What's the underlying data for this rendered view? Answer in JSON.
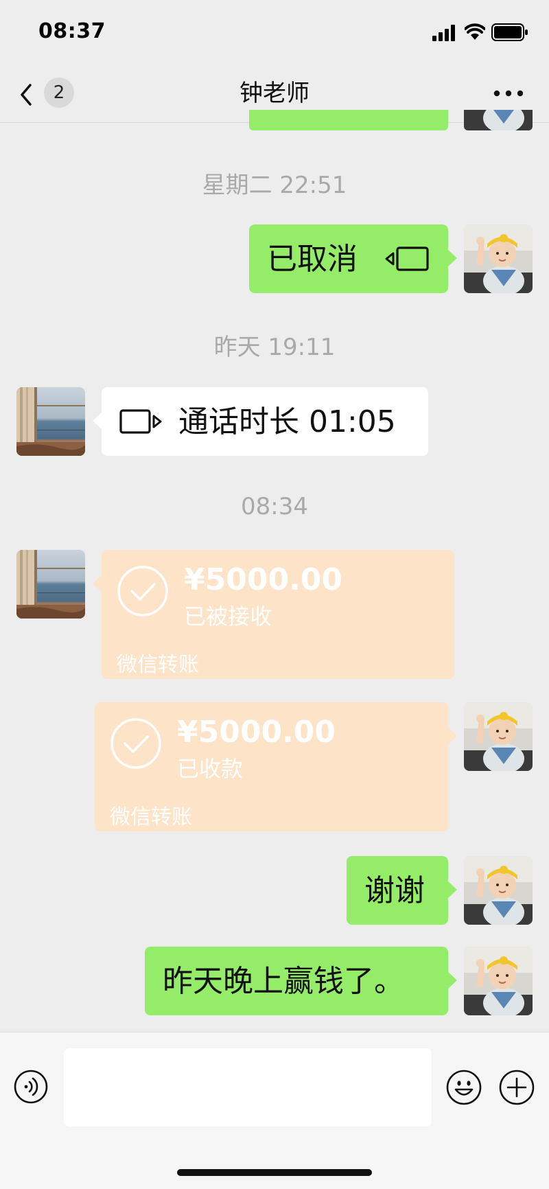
{
  "status_bar": {
    "time": "08:37"
  },
  "header": {
    "unread_count": "2",
    "title": "钟老师"
  },
  "messages": [
    {
      "type": "time",
      "text": "星期二 22:51"
    },
    {
      "type": "call",
      "from": "me",
      "text": "已取消",
      "icon": "video-call-icon"
    },
    {
      "type": "time",
      "text": "昨天 19:11"
    },
    {
      "type": "call",
      "from": "them",
      "text": "通话时长 01:05",
      "icon": "video-call-icon"
    },
    {
      "type": "time",
      "text": "08:34"
    },
    {
      "type": "transfer",
      "from": "them",
      "amount": "¥5000.00",
      "status": "已被接收",
      "label": "微信转账"
    },
    {
      "type": "transfer",
      "from": "me",
      "amount": "¥5000.00",
      "status": "已收款",
      "label": "微信转账"
    },
    {
      "type": "text",
      "from": "me",
      "text": "谢谢"
    },
    {
      "type": "text",
      "from": "me",
      "text": "昨天晚上赢钱了。"
    }
  ],
  "colors": {
    "sent_bubble": "#95ec69",
    "received_bubble": "#ffffff",
    "transfer_bubble": "#fde3c8",
    "background": "#ededed"
  },
  "input": {
    "value": "",
    "placeholder": ""
  }
}
